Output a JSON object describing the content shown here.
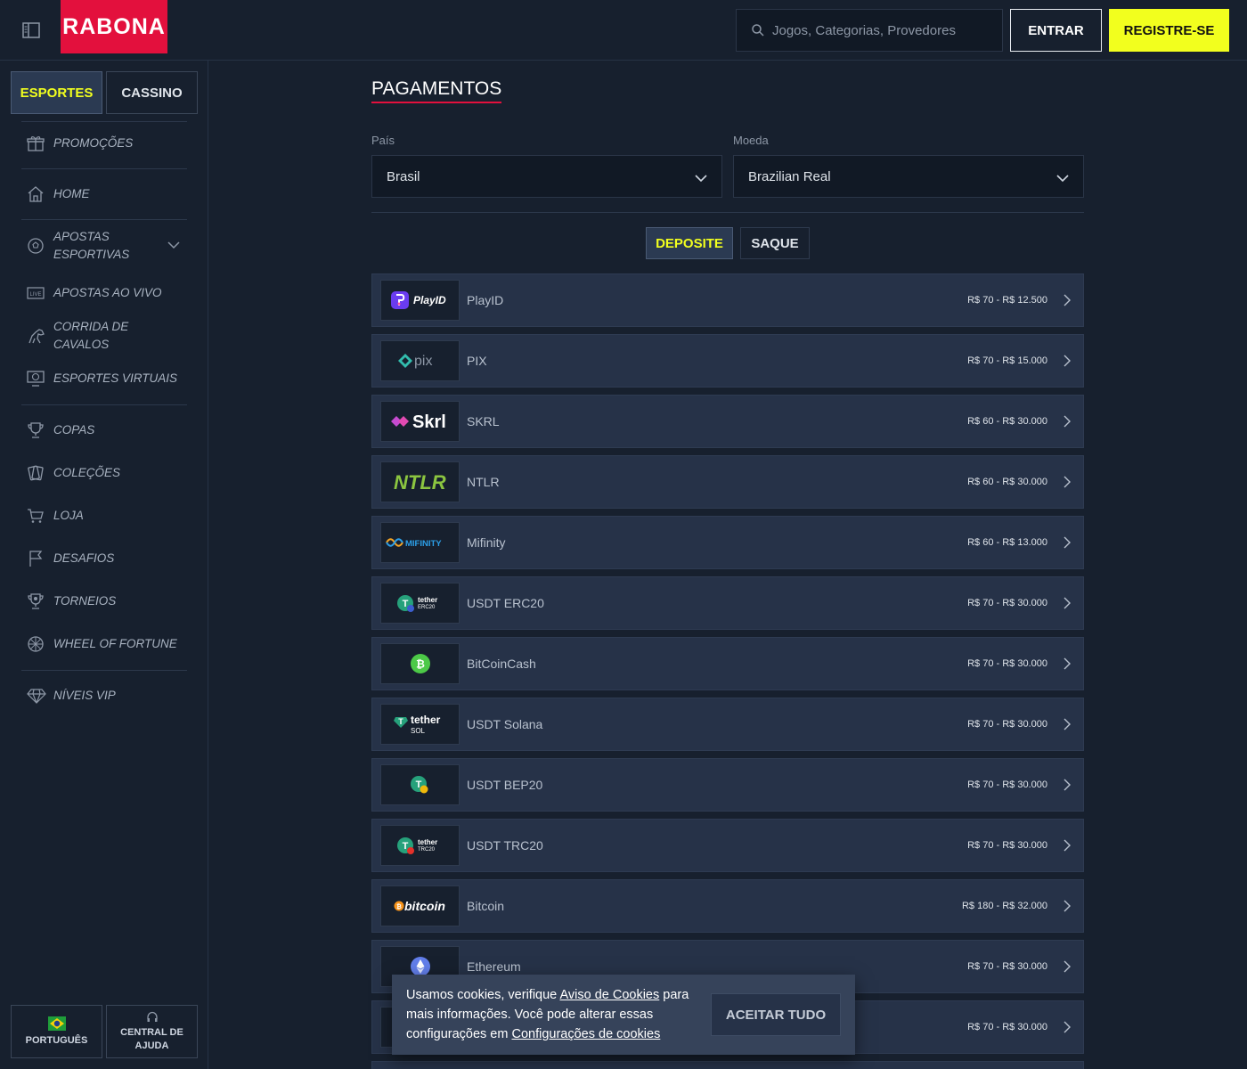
{
  "header": {
    "logo_text": "RABONA",
    "search_placeholder": "Jogos, Categorias, Provedores",
    "login_label": "ENTRAR",
    "register_label": "REGISTRE-SE"
  },
  "sidebar": {
    "tabs": [
      "ESPORTES",
      "CASSINO"
    ],
    "items": [
      {
        "label": "PROMOÇÕES",
        "icon": "gift-icon"
      },
      {
        "label": "HOME",
        "icon": "home-icon"
      },
      {
        "label": "APOSTAS ESPORTIVAS",
        "icon": "soccer-ball-icon"
      },
      {
        "label": "APOSTAS AO VIVO",
        "icon": "live-icon"
      },
      {
        "label": "CORRIDA DE CAVALOS",
        "icon": "horse-icon"
      },
      {
        "label": "ESPORTES VIRTUAIS",
        "icon": "virtual-sports-icon"
      },
      {
        "label": "COPAS",
        "icon": "trophy-icon"
      },
      {
        "label": "COLEÇÕES",
        "icon": "cards-icon"
      },
      {
        "label": "LOJA",
        "icon": "cart-icon"
      },
      {
        "label": "DESAFIOS",
        "icon": "flag-icon"
      },
      {
        "label": "TORNEIOS",
        "icon": "tournament-icon"
      },
      {
        "label": "WHEEL OF FORTUNE",
        "icon": "wheel-icon"
      },
      {
        "label": "NÍVEIS VIP",
        "icon": "diamond-icon"
      }
    ],
    "bottom": {
      "language": "PORTUGUÊS",
      "help_line1": "CENTRAL DE",
      "help_line2": "AJUDA"
    }
  },
  "main": {
    "title": "PAGAMENTOS",
    "country_label": "País",
    "country_value": "Brasil",
    "currency_label": "Moeda",
    "currency_value": "Brazilian Real",
    "tabs": [
      "DEPOSITE",
      "SAQUE"
    ],
    "methods": [
      {
        "name": "PlayID",
        "range": "R$ 70 - R$ 12.500",
        "logo": "PlayID"
      },
      {
        "name": "PIX",
        "range": "R$ 70 - R$ 15.000",
        "logo": "pix"
      },
      {
        "name": "SKRL",
        "range": "R$ 60 - R$ 30.000",
        "logo": "Skrl"
      },
      {
        "name": "NTLR",
        "range": "R$ 60 - R$ 30.000",
        "logo": "NTLR"
      },
      {
        "name": "Mifinity",
        "range": "R$ 60 - R$ 13.000",
        "logo": "MIFINITY"
      },
      {
        "name": "USDT ERC20",
        "range": "R$ 70 - R$ 30.000",
        "logo": "tether ERC20"
      },
      {
        "name": "BitCoinCash",
        "range": "R$ 70 - R$ 30.000",
        "logo": "bch"
      },
      {
        "name": "USDT Solana",
        "range": "R$ 70 - R$ 30.000",
        "logo": "tether SOL"
      },
      {
        "name": "USDT BEP20",
        "range": "R$ 70 - R$ 30.000",
        "logo": "tether BEP20"
      },
      {
        "name": "USDT TRC20",
        "range": "R$ 70 - R$ 30.000",
        "logo": "tether TRC20"
      },
      {
        "name": "Bitcoin",
        "range": "R$ 180 - R$ 32.000",
        "logo": "bitcoin"
      },
      {
        "name": "Ethereum",
        "range": "R$ 70 - R$ 30.000",
        "logo": "eth"
      },
      {
        "name": "",
        "range": "R$ 70 - R$ 30.000",
        "logo": ""
      }
    ]
  },
  "cookie": {
    "text1": "Usamos cookies, verifique ",
    "link1": "Aviso de Cookies",
    "text2": " para mais informações. Você pode alterar essas configurações em ",
    "link2": "Configurações de cookies",
    "accept_label": "ACEITAR TUDO"
  },
  "colors": {
    "accent_yellow": "#f2ff1e",
    "brand_red": "#e3103d",
    "bg": "#17202e",
    "row_bg": "#263248"
  }
}
